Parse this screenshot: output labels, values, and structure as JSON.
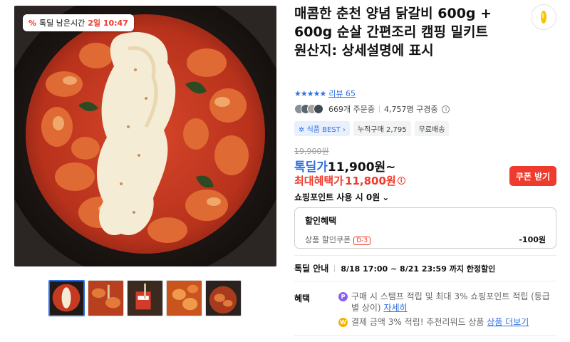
{
  "deal_chip": {
    "label": "톡딜 남은시간",
    "time": "2일 10:47"
  },
  "product": {
    "title": "매콤한 춘천 양념 닭갈비 600g + 600g 순살 간편조리 캠핑 밀키트",
    "origin": "원산지: 상세설명에 표시"
  },
  "rating": {
    "stars": "★★★★★",
    "review_text": "리뷰 65"
  },
  "stats": {
    "orders": "669개 주문중",
    "subscribers": "4,757명 구경중"
  },
  "badges": [
    {
      "label": "식품 BEST",
      "icon": "chevron-right-icon"
    },
    {
      "label": "누적구매 2,795"
    },
    {
      "label": "무료배송"
    }
  ],
  "price": {
    "original": "19,900원",
    "deal_label": "톡딜가",
    "deal_value": "11,900원~",
    "max_label": "최대혜택가",
    "max_value": "11,800원"
  },
  "coupon_button": "쿠폰 받기",
  "point_usage": "쇼핑포인트 사용 시 0원",
  "discount": {
    "title": "할인혜택",
    "coupon_label": "상품 할인쿠폰",
    "coupon_tag": "D-3",
    "amount": "-100원"
  },
  "notice": {
    "label": "톡딜 안내",
    "period": "8/18 17:00 ~ 8/21 23:59 까지 한정할인"
  },
  "benefit": {
    "label": "혜택",
    "item1_text": "구매 시 스탬프 적립 및 최대 3% 쇼핑포인트 적립 (등급별 상이)",
    "item1_link": "자세히",
    "item2_text": "결제 금액 3% 적립! 추천리워드 상품",
    "item2_link": "상품 더보기"
  },
  "colors": {
    "accent": "#2f6fe4",
    "sale": "#ef3b2d",
    "point_coin": "#8b5cf6",
    "reward_coin": "#f5b301"
  }
}
